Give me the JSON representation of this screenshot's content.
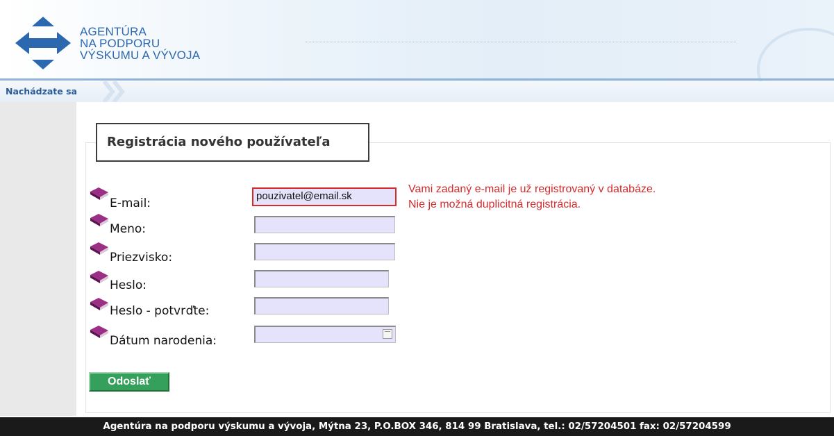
{
  "header": {
    "logo_lines": [
      "AGENTÚRA",
      "NA PODPORU",
      "VÝSKUMU A VÝVOJA"
    ],
    "logo_icon": "apvv-arrows-logo"
  },
  "breadcrumb": {
    "label": "Nachádzate sa"
  },
  "form": {
    "title": "Registrácia nového používateľa",
    "fields": [
      {
        "label": "E-mail:",
        "value": "pouzivatel@email.sk"
      },
      {
        "label": "Meno:",
        "value": ""
      },
      {
        "label": "Priezvisko:",
        "value": ""
      },
      {
        "label": "Heslo:",
        "value": ""
      },
      {
        "label": "Heslo - potvrďte:",
        "value": ""
      },
      {
        "label": "Dátum narodenia:",
        "value": ""
      }
    ],
    "error_lines": [
      "Vami zadaný e-mail je už registrovaný v databáze.",
      "Nie je možná duplicitná registrácia."
    ],
    "submit_label": "Odoslať"
  },
  "footer": {
    "text": "Agentúra na podporu výskumu a vývoja, Mýtna 23, P.O.BOX 346, 814 99 Bratislava, tel.: 02/57204501 fax: 02/57204599"
  },
  "colors": {
    "brand_blue": "#2c68b0",
    "error_red": "#d42a2a",
    "submit_green": "#34a05b",
    "field_fill": "#e5e3fc",
    "book_icon": "#7a1f66"
  }
}
